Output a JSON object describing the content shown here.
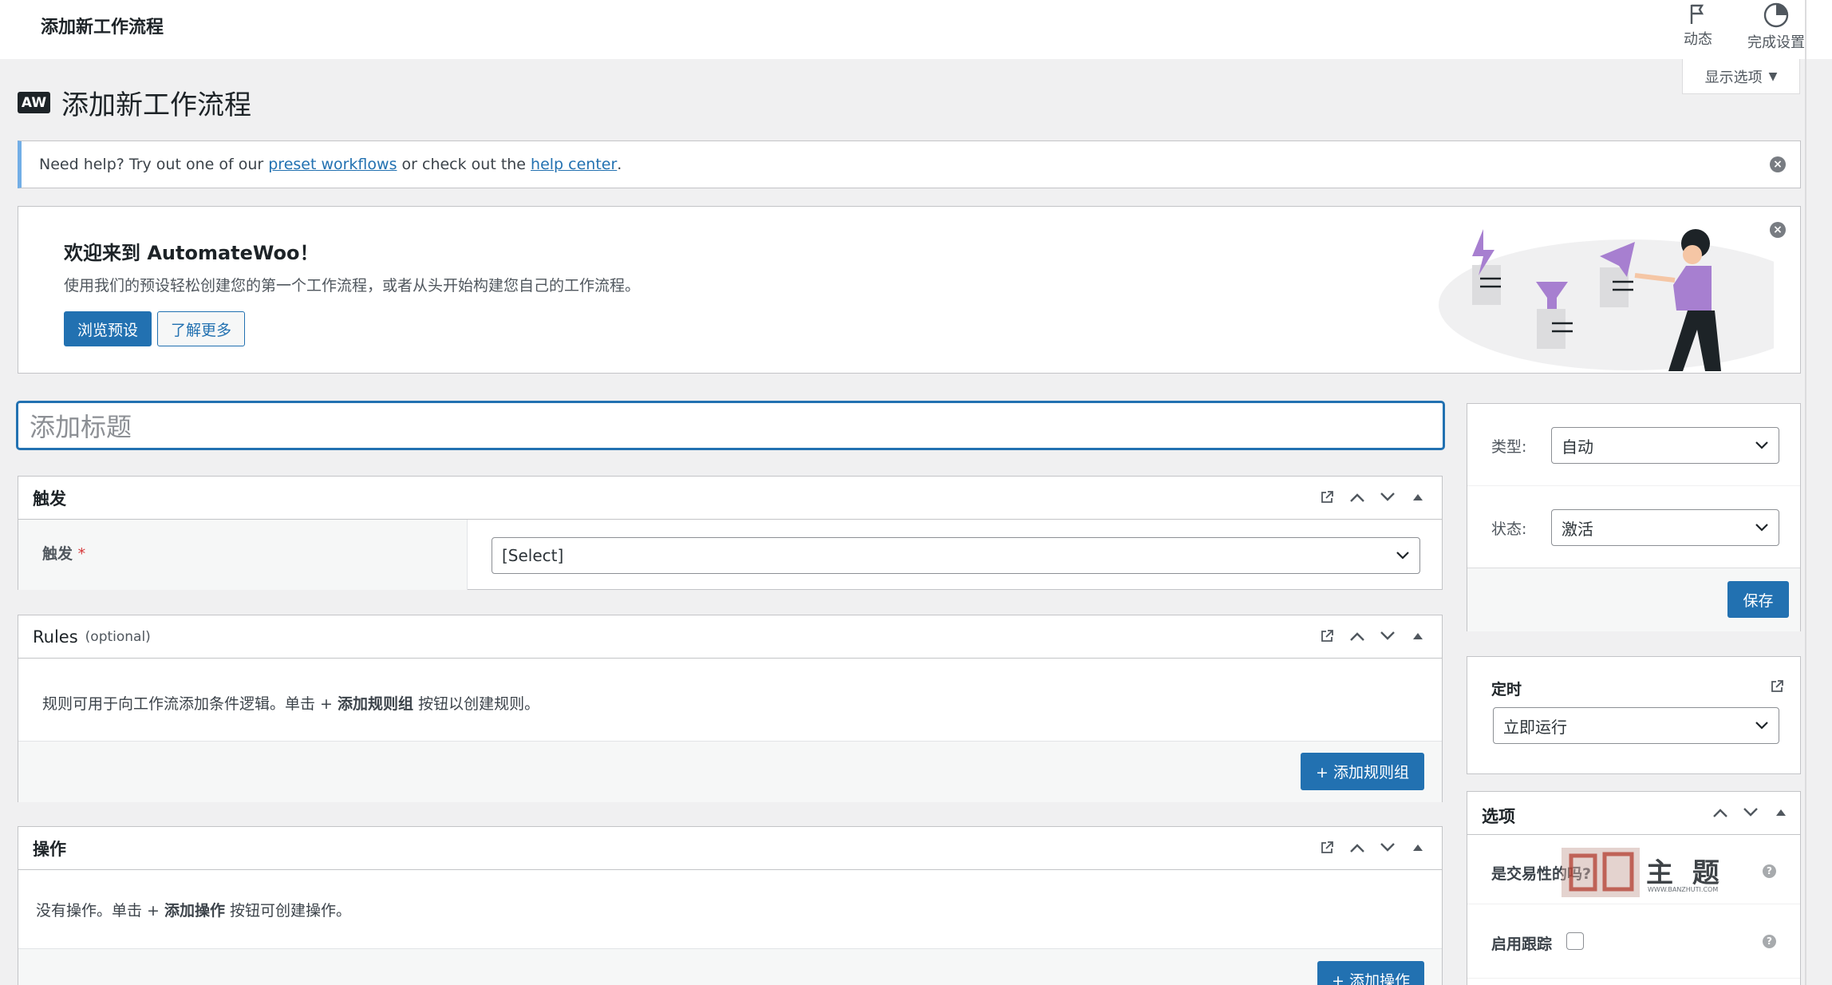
{
  "topbar": {
    "title": "添加新工作流程",
    "activity_label": "动态",
    "finish_setup_label": "完成设置",
    "screen_options_label": "显示选项"
  },
  "header": {
    "logo_text": "AW",
    "title": "添加新工作流程"
  },
  "notice": {
    "text_before": "Need help? Try out one of our ",
    "link1": "preset workflows",
    "text_middle": " or check out the ",
    "link2": "help center",
    "text_after": "."
  },
  "welcome": {
    "title": "欢迎来到 AutomateWoo！",
    "description": "使用我们的预设轻松创建您的第一个工作流程，或者从头开始构建您自己的工作流程。",
    "browse_button": "浏览预设",
    "learn_button": "了解更多"
  },
  "title_input": {
    "placeholder": "添加标题"
  },
  "trigger_box": {
    "title": "触发",
    "field_label": "触发",
    "required_mark": "*",
    "select_value": "[Select]"
  },
  "rules_box": {
    "title": "Rules",
    "optional": "(optional)",
    "desc_before": "规则可用于向工作流添加条件逻辑。单击 + ",
    "desc_bold": "添加规则组",
    "desc_after": " 按钮以创建规则。",
    "add_button": "+ 添加规则组"
  },
  "actions_box": {
    "title": "操作",
    "desc_before": "没有操作。单击 + ",
    "desc_bold": "添加操作",
    "desc_after": " 按钮可创建操作。",
    "add_button": "+ 添加操作"
  },
  "publish_box": {
    "type_label": "类型:",
    "type_value": "自动",
    "status_label": "状态:",
    "status_value": "激活",
    "save_button": "保存"
  },
  "timing_box": {
    "title": "定时",
    "select_value": "立即运行"
  },
  "options_box": {
    "title": "选项",
    "transactional_label": "是交易性的吗?",
    "tracking_label": "启用跟踪"
  },
  "watermark": {
    "text": "主 题",
    "url": "WWW.BANZHUTI.COM"
  },
  "colors": {
    "primary": "#2271b1",
    "notice_border": "#72aee6",
    "illustration_purple": "#a77fd0"
  }
}
